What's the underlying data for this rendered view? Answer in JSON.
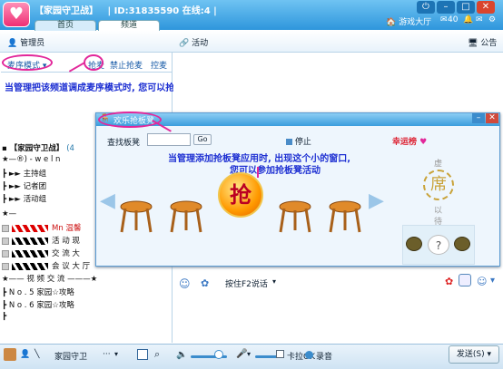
{
  "window": {
    "title": "【家园守卫战】   | ID:31835590 在线:4 |",
    "tabs": [
      "首页",
      "频道"
    ],
    "hall_label": "游戏大厅",
    "count_label": "40"
  },
  "toolbar": {
    "admin_label": "管理员",
    "activity_label": "活动",
    "notice_label": "公告"
  },
  "modebar": {
    "mode_select": "麦序模式",
    "grab_mic": "抢麦",
    "no_grab": "禁止抢麦",
    "control_mic": "控麦"
  },
  "annotations": {
    "note1": "当管理把该频道调成麦序模式时, 您可以抢麦说话",
    "note2_line1": "当管理添加抢板凳应用时, 出现这个小的窗口,",
    "note2_line2": "您可以参加抢板凳活动"
  },
  "tree": {
    "root": "【家园守卫战】",
    "root_count": "(4",
    "rows": [
      "★—®) - w e l n",
      "┣    ►►  主持组",
      "┣    ►►  记者团",
      "┣    ►►  活动组",
      "★—",
      "Mn 温馨",
      "活 动  现",
      "交 流  大",
      "会 议  大 厅",
      "★——  视 频 交 流  ———★",
      "┣    N o . 5     家园☆攻略",
      "┣    N o . 6     家园☆攻略",
      "┣"
    ]
  },
  "popup": {
    "title": "欢乐抢板凳",
    "search_label": "查找板凳",
    "go_label": "Go",
    "stop_label": "停止",
    "lucky_label": "幸运榜",
    "grab_button": "抢",
    "wait_char1": "虚",
    "wait_char2": "以",
    "wait_char3": "待",
    "wait_big": "席",
    "question": "?"
  },
  "voice": {
    "ptt_label": "按住F2说话"
  },
  "bottombar": {
    "channel_name": "家园守卫",
    "more": "···",
    "checkbox_label": "卡拉OK",
    "record_label": "录音",
    "send_label": "发送(S)"
  }
}
